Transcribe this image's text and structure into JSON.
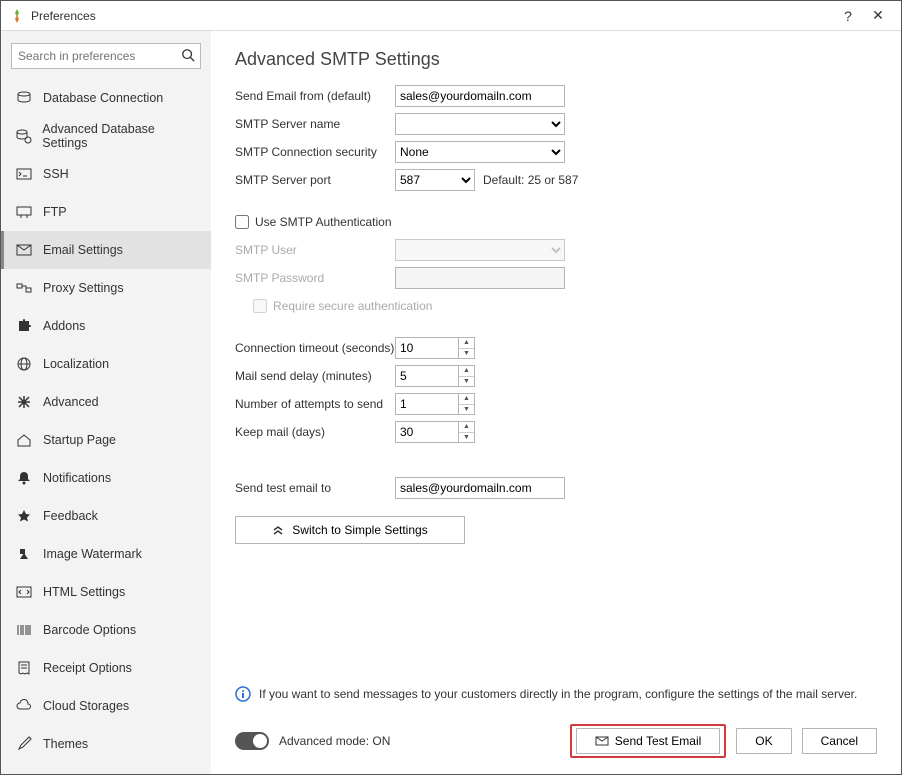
{
  "window": {
    "title": "Preferences",
    "help": "?",
    "close": "✕"
  },
  "search": {
    "placeholder": "Search in preferences"
  },
  "sidebar": {
    "items": [
      {
        "label": "Database Connection"
      },
      {
        "label": "Advanced Database Settings"
      },
      {
        "label": "SSH"
      },
      {
        "label": "FTP"
      },
      {
        "label": "Email Settings"
      },
      {
        "label": "Proxy Settings"
      },
      {
        "label": "Addons"
      },
      {
        "label": "Localization"
      },
      {
        "label": "Advanced"
      },
      {
        "label": "Startup Page"
      },
      {
        "label": "Notifications"
      },
      {
        "label": "Feedback"
      },
      {
        "label": "Image Watermark"
      },
      {
        "label": "HTML Settings"
      },
      {
        "label": "Barcode Options"
      },
      {
        "label": "Receipt Options"
      },
      {
        "label": "Cloud Storages"
      },
      {
        "label": "Themes"
      }
    ]
  },
  "page": {
    "title": "Advanced SMTP Settings",
    "labels": {
      "send_from": "Send Email from (default)",
      "server_name": "SMTP Server name",
      "conn_sec": "SMTP Connection security",
      "server_port": "SMTP Server port",
      "port_default": "Default: 25 or 587",
      "use_auth": "Use SMTP Authentication",
      "smtp_user": "SMTP User",
      "smtp_pass": "SMTP Password",
      "req_secure": "Require secure authentication",
      "timeout": "Connection timeout (seconds)",
      "delay": "Mail send delay (minutes)",
      "attempts": "Number of attempts to send",
      "keep": "Keep mail (days)",
      "test_to": "Send test email to",
      "switch_simple": "Switch to Simple Settings"
    },
    "values": {
      "send_from": "sales@yourdomailn.com",
      "server_name": "",
      "conn_sec": "None",
      "server_port": "587",
      "use_auth": false,
      "smtp_user": "",
      "smtp_pass": "",
      "req_secure": false,
      "timeout": "10",
      "delay": "5",
      "attempts": "1",
      "keep": "30",
      "test_to": "sales@yourdomailn.com"
    },
    "info": "If you want to send messages to your customers directly in the program, configure the settings of the mail server."
  },
  "footer": {
    "mode_label": "Advanced mode: ON",
    "send_test": "Send Test Email",
    "ok": "OK",
    "cancel": "Cancel"
  }
}
